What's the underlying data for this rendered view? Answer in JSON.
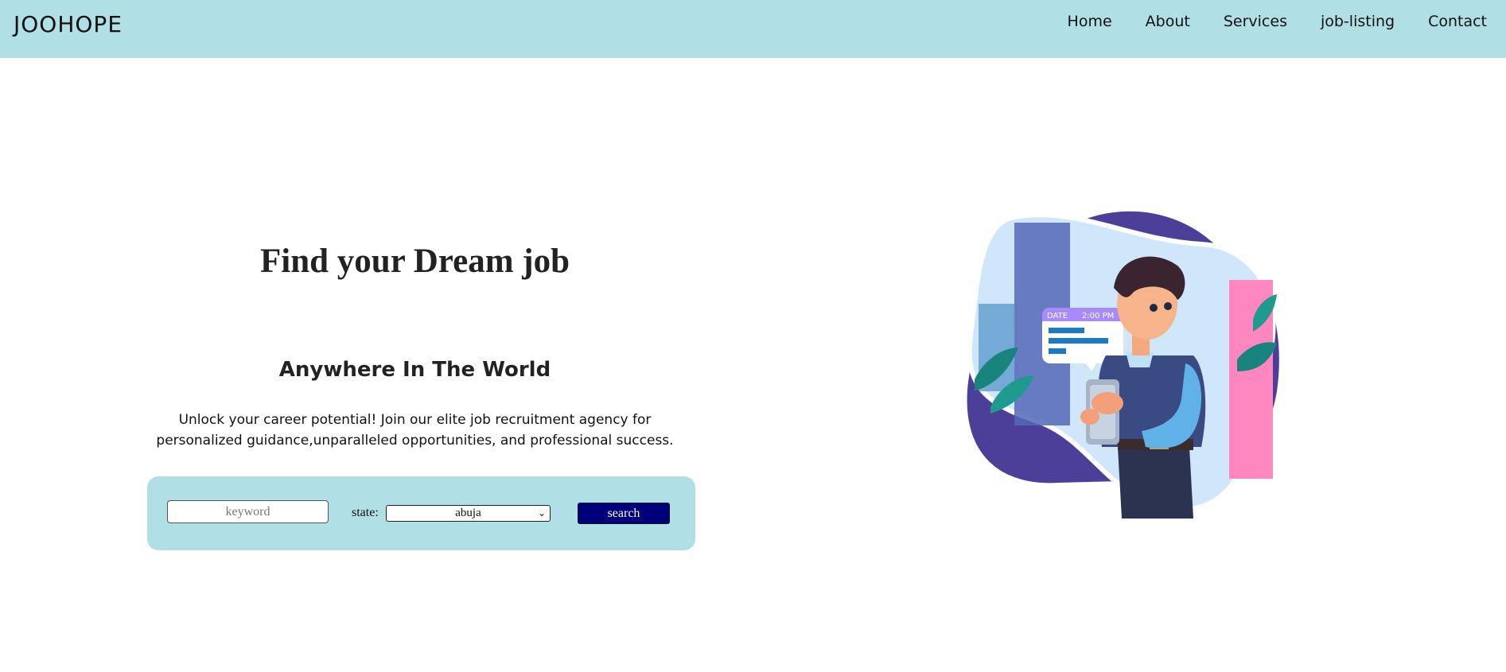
{
  "header": {
    "logo": "JOOHOPE",
    "nav": [
      "Home",
      "About",
      "Services",
      "job-listing",
      "Contact"
    ]
  },
  "hero": {
    "title": "Find your Dream job",
    "subtitle": "Anywhere In The World",
    "description": "Unlock your career potential! Join our elite job recruitment agency for personalized guidance,unparalleled opportunities, and professional success."
  },
  "search": {
    "keyword_placeholder": "keyword",
    "state_label": "state:",
    "state_value": "abuja",
    "button_label": "search"
  },
  "illustration": {
    "card_date": "DATE",
    "card_time": "2:00 PM"
  },
  "colors": {
    "header_bg": "#b0e0e6",
    "button_bg": "#00007a",
    "blob": "#4b3f9a"
  }
}
